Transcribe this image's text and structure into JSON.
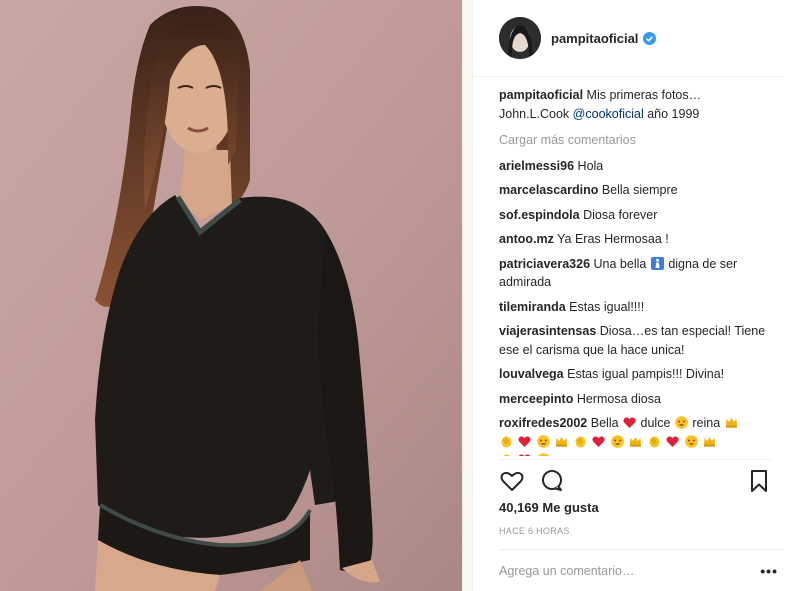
{
  "post": {
    "username": "pampitaoficial",
    "caption_text": "Mis primeras fotos…",
    "caption_line2_prefix": "John.L.Cook",
    "caption_mention": "@cookoficial",
    "caption_line2_suffix": "año 1999",
    "load_more": "Cargar más comentarios",
    "likes": "40,169 Me gusta",
    "time": "HACE 6 HORAS",
    "add_comment_placeholder": "Agrega un comentario…",
    "options": "•••"
  },
  "comments": [
    {
      "user": "arielmessi96",
      "text": "Hola"
    },
    {
      "user": "marcelascardino",
      "text": "Bella siempre"
    },
    {
      "user": "sof.espindola",
      "text": "Diosa forever"
    },
    {
      "user": "antoo.mz",
      "text": "Ya Eras Hermosaa !"
    },
    {
      "user": "patriciavera326",
      "text_before": "Una bella",
      "text_after": "digna de ser admirada"
    },
    {
      "user": "tilemiranda",
      "text": "Estas igual!!!!"
    },
    {
      "user": "viajerasintensas",
      "text": "Diosa…es tan especial! Tiene ese el carisma que la hace unica!"
    },
    {
      "user": "louvalvega",
      "text": "Estas igual pampis!!! Divina!"
    },
    {
      "user": "merceepinto",
      "text": "Hermosa diosa"
    },
    {
      "user": "roxifredes2002",
      "w1": "Bella",
      "w2": "dulce",
      "w3": "reina"
    }
  ],
  "icons": {
    "verified": "verified-badge-icon",
    "heart": "heart-outline-icon",
    "comment": "comment-bubble-icon",
    "save": "bookmark-icon"
  },
  "colors": {
    "verified": "#3897f0",
    "link": "#003569",
    "muted": "#999999",
    "border": "#efefef"
  }
}
